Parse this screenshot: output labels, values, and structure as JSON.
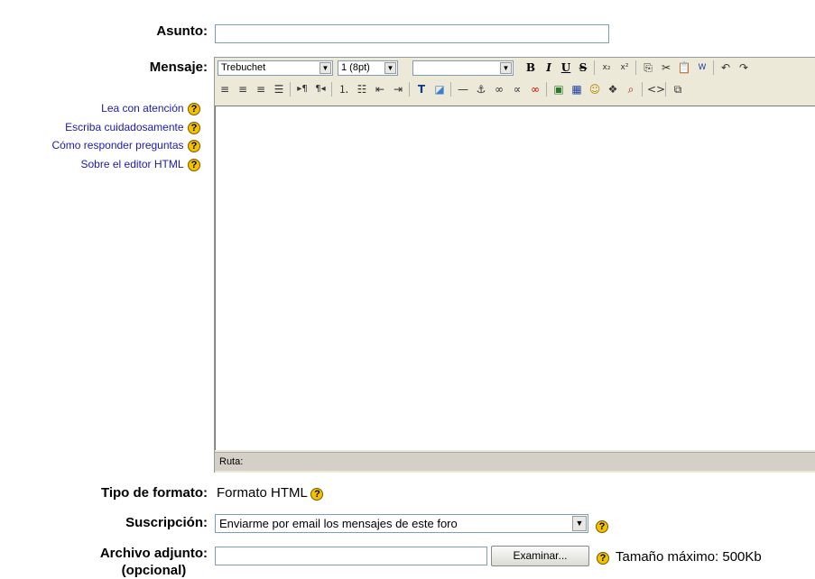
{
  "labels": {
    "subject": "Asunto:",
    "message": "Mensaje:",
    "format": "Tipo de formato:",
    "subscription": "Suscripción:",
    "attachment_line1": "Archivo adjunto:",
    "attachment_line2": "(opcional)"
  },
  "help_links": [
    "Lea con atención",
    "Escriba cuidadosamente",
    "Cómo responder preguntas",
    "Sobre el editor HTML"
  ],
  "editor": {
    "font_value": "Trebuchet",
    "size_value": "1 (8pt)",
    "style_value": "",
    "path_label": "Ruta:",
    "toolbar1": [
      "bold-icon",
      "italic-icon",
      "underline-icon",
      "strikethrough-icon",
      "subscript-icon",
      "superscript-icon",
      "copy-icon",
      "cut-icon",
      "paste-icon",
      "paste-word-icon",
      "undo-icon",
      "redo-icon"
    ],
    "toolbar2": [
      "align-left-icon",
      "align-center-icon",
      "align-right-icon",
      "justify-icon",
      "ltr-icon",
      "rtl-icon",
      "ordered-list-icon",
      "unordered-list-icon",
      "outdent-icon",
      "indent-icon",
      "text-color-icon",
      "background-color-icon",
      "horizontal-rule-icon",
      "anchor-icon",
      "link-icon",
      "unlink-icon",
      "nolink-icon",
      "image-icon",
      "table-icon",
      "smiley-icon",
      "special-char-icon",
      "search-replace-icon",
      "html-source-icon",
      "fullscreen-icon"
    ]
  },
  "format_value": "Formato HTML",
  "subscription_value": "Enviarme por email los mensajes de este foro",
  "attachment": {
    "browse_label": "Examinar...",
    "max_size": "Tamaño máximo: 500Kb"
  },
  "help_glyph": "?"
}
